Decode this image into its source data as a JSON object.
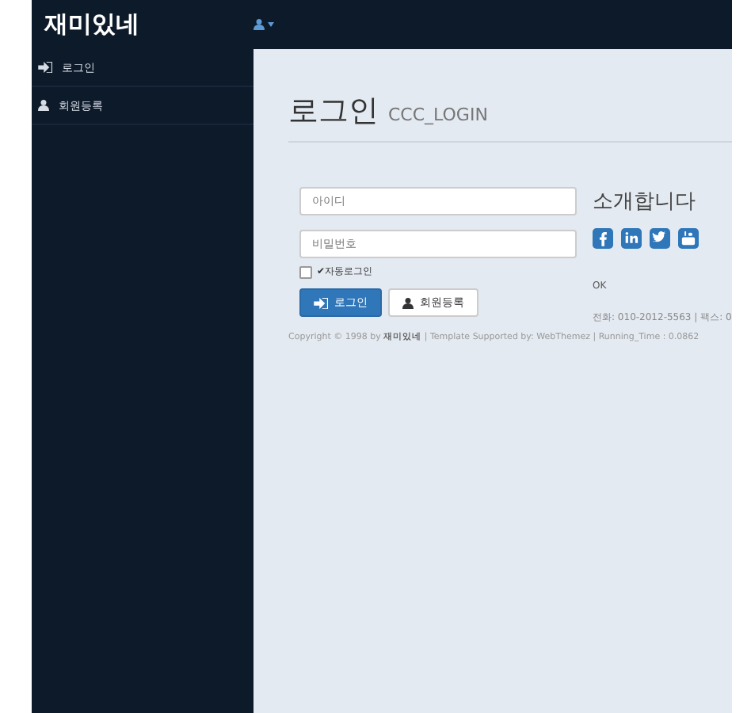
{
  "brand": "재미있네",
  "sidebar": {
    "items": [
      {
        "label": "로그인",
        "kind": "signin"
      },
      {
        "label": "회원등록",
        "kind": "user"
      }
    ]
  },
  "heading": {
    "title": "로그인",
    "subtitle": "CCC_LOGIN"
  },
  "form": {
    "id_field": {
      "placeholder": "아이디"
    },
    "password_field": {
      "placeholder": "비밀번호"
    },
    "remember": {
      "label": "✔자동로그인",
      "checked": false
    },
    "buttons": [
      {
        "label": "로그인",
        "kind": "signin"
      },
      {
        "label": "회원등록",
        "kind": "user"
      }
    ]
  },
  "intro": {
    "title": "소개합니다",
    "status": "OK",
    "contact": "전화: 010-2012-5563 | 팩스: 0"
  },
  "footer": "Copyright © 1998 by **재미있네** | Template Supported by: WebThemez | Running_Time : 0.0862"
}
